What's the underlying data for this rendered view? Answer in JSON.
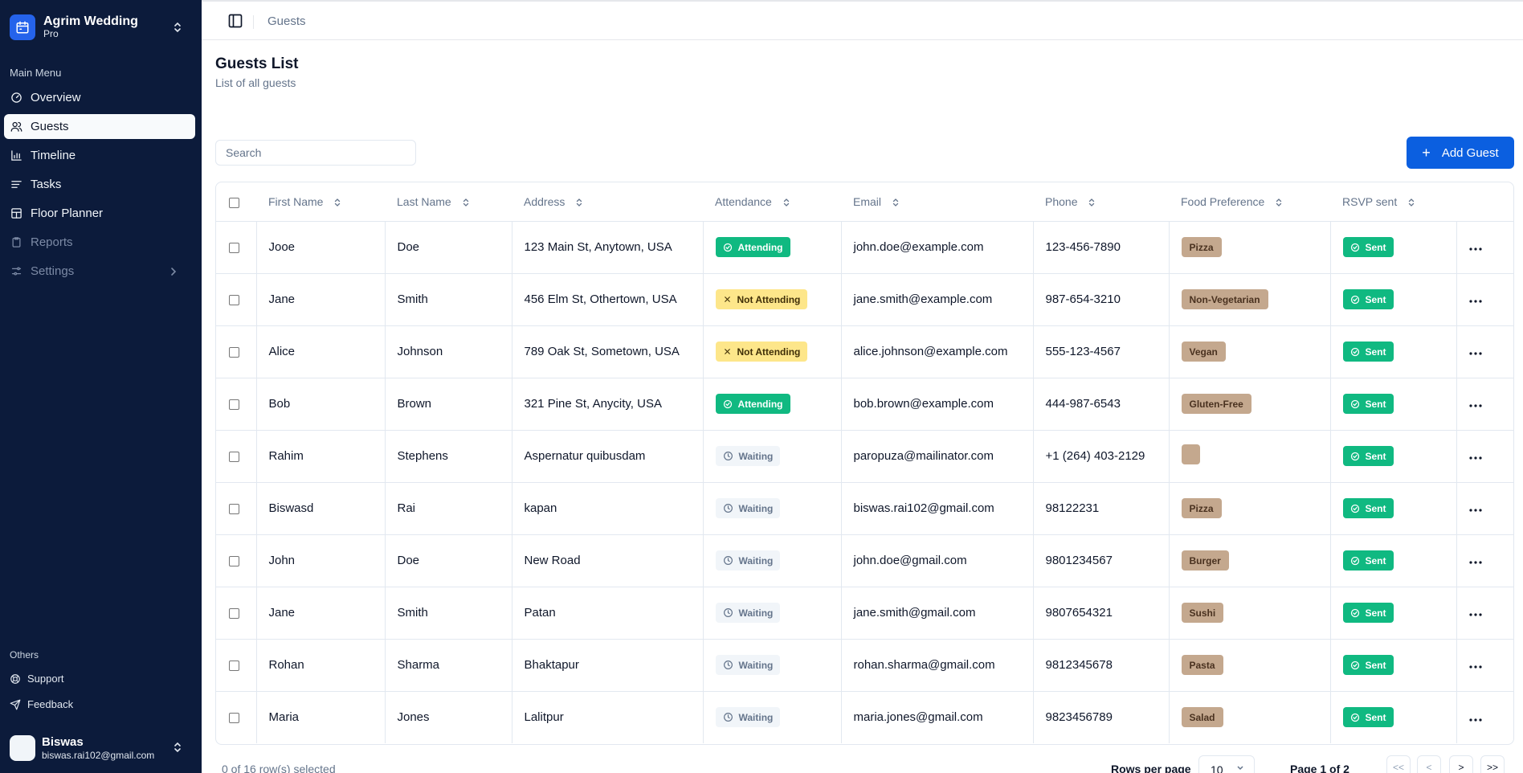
{
  "workspace": {
    "name": "Agrim Wedding",
    "plan": "Pro"
  },
  "sidebar": {
    "main_menu_label": "Main Menu",
    "items": [
      {
        "label": "Overview",
        "icon": "gauge-icon",
        "state": "normal"
      },
      {
        "label": "Guests",
        "icon": "users-icon",
        "state": "active"
      },
      {
        "label": "Timeline",
        "icon": "chart-icon",
        "state": "normal"
      },
      {
        "label": "Tasks",
        "icon": "list-icon",
        "state": "normal"
      },
      {
        "label": "Floor Planner",
        "icon": "layout-icon",
        "state": "normal"
      },
      {
        "label": "Reports",
        "icon": "clipboard-icon",
        "state": "disabled"
      },
      {
        "label": "Settings",
        "icon": "sliders-icon",
        "state": "disabled"
      }
    ],
    "others_label": "Others",
    "others": [
      {
        "label": "Support",
        "icon": "lifebuoy-icon"
      },
      {
        "label": "Feedback",
        "icon": "send-icon"
      }
    ]
  },
  "user": {
    "name": "Biswas",
    "email": "biswas.rai102@gmail.com"
  },
  "breadcrumb": "Guests",
  "page": {
    "title": "Guests List",
    "subtitle": "List of all guests"
  },
  "search": {
    "placeholder": "Search",
    "value": ""
  },
  "add_button": "Add Guest",
  "table": {
    "columns": [
      "First Name",
      "Last Name",
      "Address",
      "Attendance",
      "Email",
      "Phone",
      "Food Preference",
      "RSVP sent"
    ],
    "rows": [
      {
        "first": "Jooe",
        "last": "Doe",
        "address": "123 Main St, Anytown, USA",
        "attendance": "Attending",
        "email": "john.doe@example.com",
        "phone": "123-456-7890",
        "food": "Pizza",
        "rsvp": "Sent"
      },
      {
        "first": "Jane",
        "last": "Smith",
        "address": "456 Elm St, Othertown, USA",
        "attendance": "Not Attending",
        "email": "jane.smith@example.com",
        "phone": "987-654-3210",
        "food": "Non-Vegetarian",
        "rsvp": "Sent"
      },
      {
        "first": "Alice",
        "last": "Johnson",
        "address": "789 Oak St, Sometown, USA",
        "attendance": "Not Attending",
        "email": "alice.johnson@example.com",
        "phone": "555-123-4567",
        "food": "Vegan",
        "rsvp": "Sent"
      },
      {
        "first": "Bob",
        "last": "Brown",
        "address": "321 Pine St, Anycity, USA",
        "attendance": "Attending",
        "email": "bob.brown@example.com",
        "phone": "444-987-6543",
        "food": "Gluten-Free",
        "rsvp": "Sent"
      },
      {
        "first": "Rahim",
        "last": "Stephens",
        "address": "Aspernatur quibusdam",
        "attendance": "Waiting",
        "email": "paropuza@mailinator.com",
        "phone": "+1 (264) 403-2129",
        "food": "",
        "rsvp": "Sent"
      },
      {
        "first": "Biswasd",
        "last": "Rai",
        "address": "kapan",
        "attendance": "Waiting",
        "email": "biswas.rai102@gmail.com",
        "phone": "98122231",
        "food": "Pizza",
        "rsvp": "Sent"
      },
      {
        "first": "John",
        "last": "Doe",
        "address": "New Road",
        "attendance": "Waiting",
        "email": "john.doe@gmail.com",
        "phone": "9801234567",
        "food": "Burger",
        "rsvp": "Sent"
      },
      {
        "first": "Jane",
        "last": "Smith",
        "address": "Patan",
        "attendance": "Waiting",
        "email": "jane.smith@gmail.com",
        "phone": "9807654321",
        "food": "Sushi",
        "rsvp": "Sent"
      },
      {
        "first": "Rohan",
        "last": "Sharma",
        "address": "Bhaktapur",
        "attendance": "Waiting",
        "email": "rohan.sharma@gmail.com",
        "phone": "9812345678",
        "food": "Pasta",
        "rsvp": "Sent"
      },
      {
        "first": "Maria",
        "last": "Jones",
        "address": "Lalitpur",
        "attendance": "Waiting",
        "email": "maria.jones@gmail.com",
        "phone": "9823456789",
        "food": "Salad",
        "rsvp": "Sent"
      }
    ]
  },
  "footer": {
    "selected": "0 of 16 row(s) selected",
    "rows_per_page_label": "Rows per page",
    "rows_per_page_value": "10",
    "page_label": "Page 1 of 2",
    "first_glyph": "<<",
    "prev_glyph": "<",
    "next_glyph": ">",
    "last_glyph": ">>"
  },
  "colors": {
    "sidebar": "#0c1b3b",
    "accent": "#0b5fe0",
    "attending": "#10b981",
    "not_attending": "#fde68a",
    "food": "#c4a88e"
  }
}
